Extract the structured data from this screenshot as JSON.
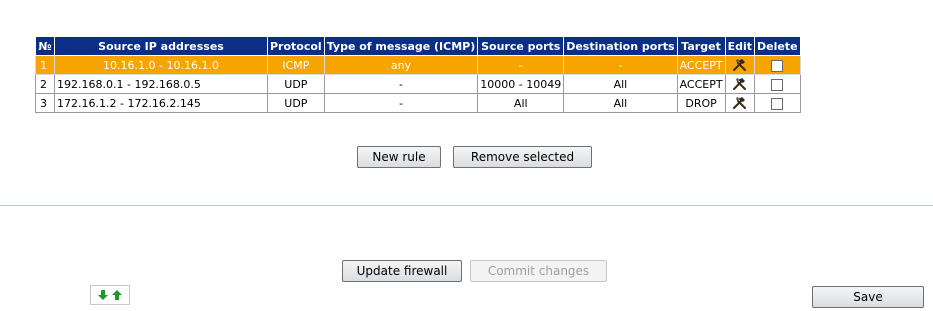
{
  "table": {
    "headers": [
      "№",
      "Source IP addresses",
      "Protocol",
      "Type of message (ICMP)",
      "Source ports",
      "Destination ports",
      "Target",
      "Edit",
      "Delete"
    ],
    "rows": [
      {
        "num": "1",
        "ip": "10.16.1.0 - 10.16.1.0",
        "protocol": "ICMP",
        "icmp": "any",
        "src_ports": "-",
        "dst_ports": "-",
        "target": "ACCEPT",
        "selected": true
      },
      {
        "num": "2",
        "ip": "192.168.0.1 - 192.168.0.5",
        "protocol": "UDP",
        "icmp": "-",
        "src_ports": "10000 - 10049",
        "dst_ports": "All",
        "target": "ACCEPT",
        "selected": false
      },
      {
        "num": "3",
        "ip": "172.16.1.2 - 172.16.2.145",
        "protocol": "UDP",
        "icmp": "-",
        "src_ports": "All",
        "dst_ports": "All",
        "target": "DROP",
        "selected": false
      }
    ]
  },
  "buttons": {
    "new_rule": "New rule",
    "remove_selected": "Remove selected",
    "update_firewall": "Update firewall",
    "commit_changes": "Commit changes",
    "save": "Save"
  },
  "icons": {
    "edit": "hammer-wrench-icon",
    "reorder": "up-down-arrows-icon"
  },
  "colors": {
    "header_bg": "#0b2f86",
    "selected_row": "#f7a300",
    "arrow_green": "#1a9a2a"
  }
}
